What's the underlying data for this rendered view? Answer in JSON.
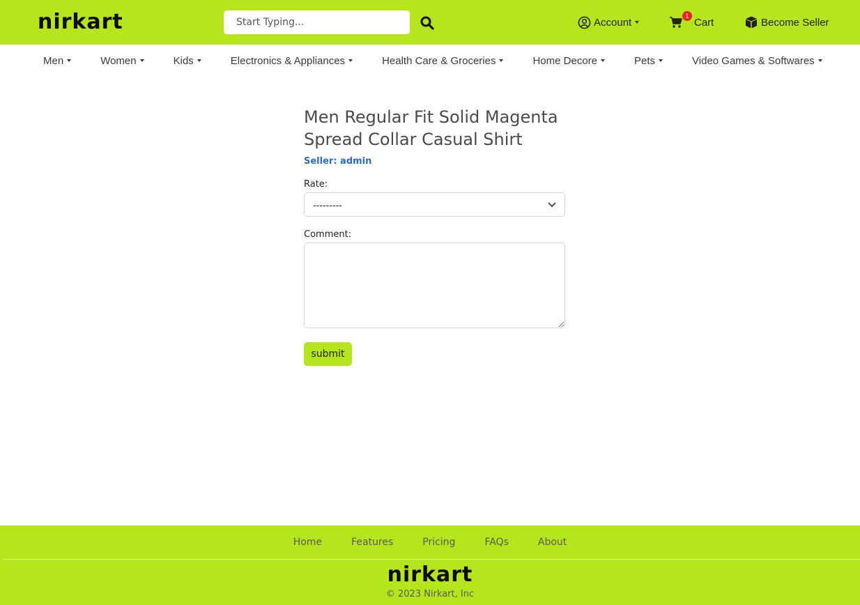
{
  "header": {
    "logo": "nirkart",
    "search_placeholder": "Start Typing...",
    "account_label": "Account",
    "cart_label": "Cart",
    "cart_count": "1",
    "seller_label": "Become Seller"
  },
  "categories": [
    {
      "label": "Men"
    },
    {
      "label": "Women"
    },
    {
      "label": "Kids"
    },
    {
      "label": "Electronics & Appliances"
    },
    {
      "label": "Health Care & Groceries"
    },
    {
      "label": "Home Decore"
    },
    {
      "label": "Pets"
    },
    {
      "label": "Video Games & Softwares"
    }
  ],
  "review_form": {
    "product_title": "Men Regular Fit Solid Magenta Spread Collar Casual Shirt",
    "seller_text": "Seller: admin",
    "rate_label": "Rate:",
    "rate_selected": "---------",
    "comment_label": "Comment:",
    "comment_value": "",
    "submit_label": "submit"
  },
  "footer": {
    "links": [
      "Home",
      "Features",
      "Pricing",
      "FAQs",
      "About"
    ],
    "logo": "nirkart",
    "copyright": "© 2023 Nirkart, Inc"
  },
  "colors": {
    "brand": "#b5e61d",
    "seller_link": "#2b6cc6",
    "badge": "#e8231b"
  },
  "icons": {
    "search": "search-icon",
    "account": "user-circle-icon",
    "cart": "cart-icon",
    "seller": "box-icon",
    "dropdown": "chevron-down-icon"
  }
}
